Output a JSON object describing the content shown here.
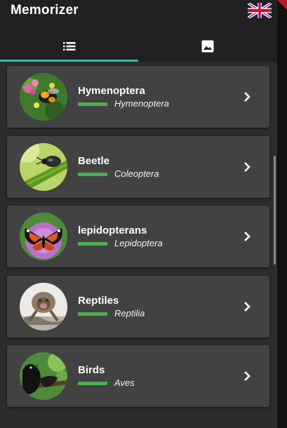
{
  "app": {
    "title": "Memorizer",
    "language_flag": "uk-flag-icon"
  },
  "tabs": [
    {
      "icon": "list-icon",
      "selected": true
    },
    {
      "icon": "image-icon",
      "selected": false
    }
  ],
  "colors": {
    "tab_indicator": "#30b7a5",
    "progress": "#4caf50",
    "card_background": "#424242",
    "app_background": "#2c2c2c",
    "topbar_background": "#212121"
  },
  "categories": [
    {
      "name": "Hymenoptera",
      "latin": "Hymenoptera",
      "image": "bee-on-flowers-photo"
    },
    {
      "name": "Beetle",
      "latin": "Coleoptera",
      "image": "beetle-on-leaf-photo"
    },
    {
      "name": "lepidopterans",
      "latin": "Lepidoptera",
      "image": "butterfly-on-flower-photo"
    },
    {
      "name": "Reptiles",
      "latin": "Reptilia",
      "image": "frilled-lizard-photo"
    },
    {
      "name": "Birds",
      "latin": "Aves",
      "image": "black-bird-photo"
    }
  ]
}
